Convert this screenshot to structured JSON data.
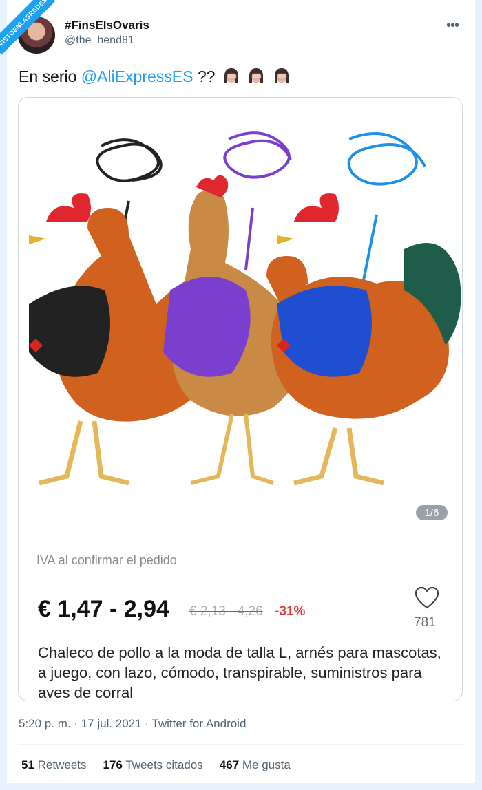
{
  "watermark": "VISTOENLASREDES",
  "author": {
    "display_name": "#FinsElsOvaris",
    "handle": "@the_hend81"
  },
  "tweet": {
    "text_prefix": "En serio ",
    "mention": "@AliExpressES",
    "text_suffix": " ??",
    "emoji": [
      "woman-facepalming-icon",
      "woman-facepalming-icon",
      "woman-facepalming-icon"
    ]
  },
  "product_card": {
    "image_alt": "Three roosters wearing black, purple and blue mesh harnesses with matching leashes",
    "page_indicator": "1/6",
    "tax_note": "IVA al confirmar el pedido",
    "price": "€ 1,47 - 2,94",
    "old_price": "€ 2,13 - 4,26",
    "discount": "-31%",
    "likes": "781",
    "title": "Chaleco de pollo a la moda de talla L, arnés para mascotas, a juego, con lazo, cómodo, transpirable, suministros para aves de corral"
  },
  "meta": {
    "timestamp": "5:20 p. m. · 17 jul. 2021 · Twitter for Android"
  },
  "stats": {
    "retweets_count": "51",
    "retweets_label": "Retweets",
    "quotes_count": "176",
    "quotes_label": "Tweets citados",
    "likes_count": "467",
    "likes_label": "Me gusta"
  },
  "colors": {
    "link": "#1d9bf0",
    "discount": "#e53935",
    "frame": "#e8f2fc"
  }
}
